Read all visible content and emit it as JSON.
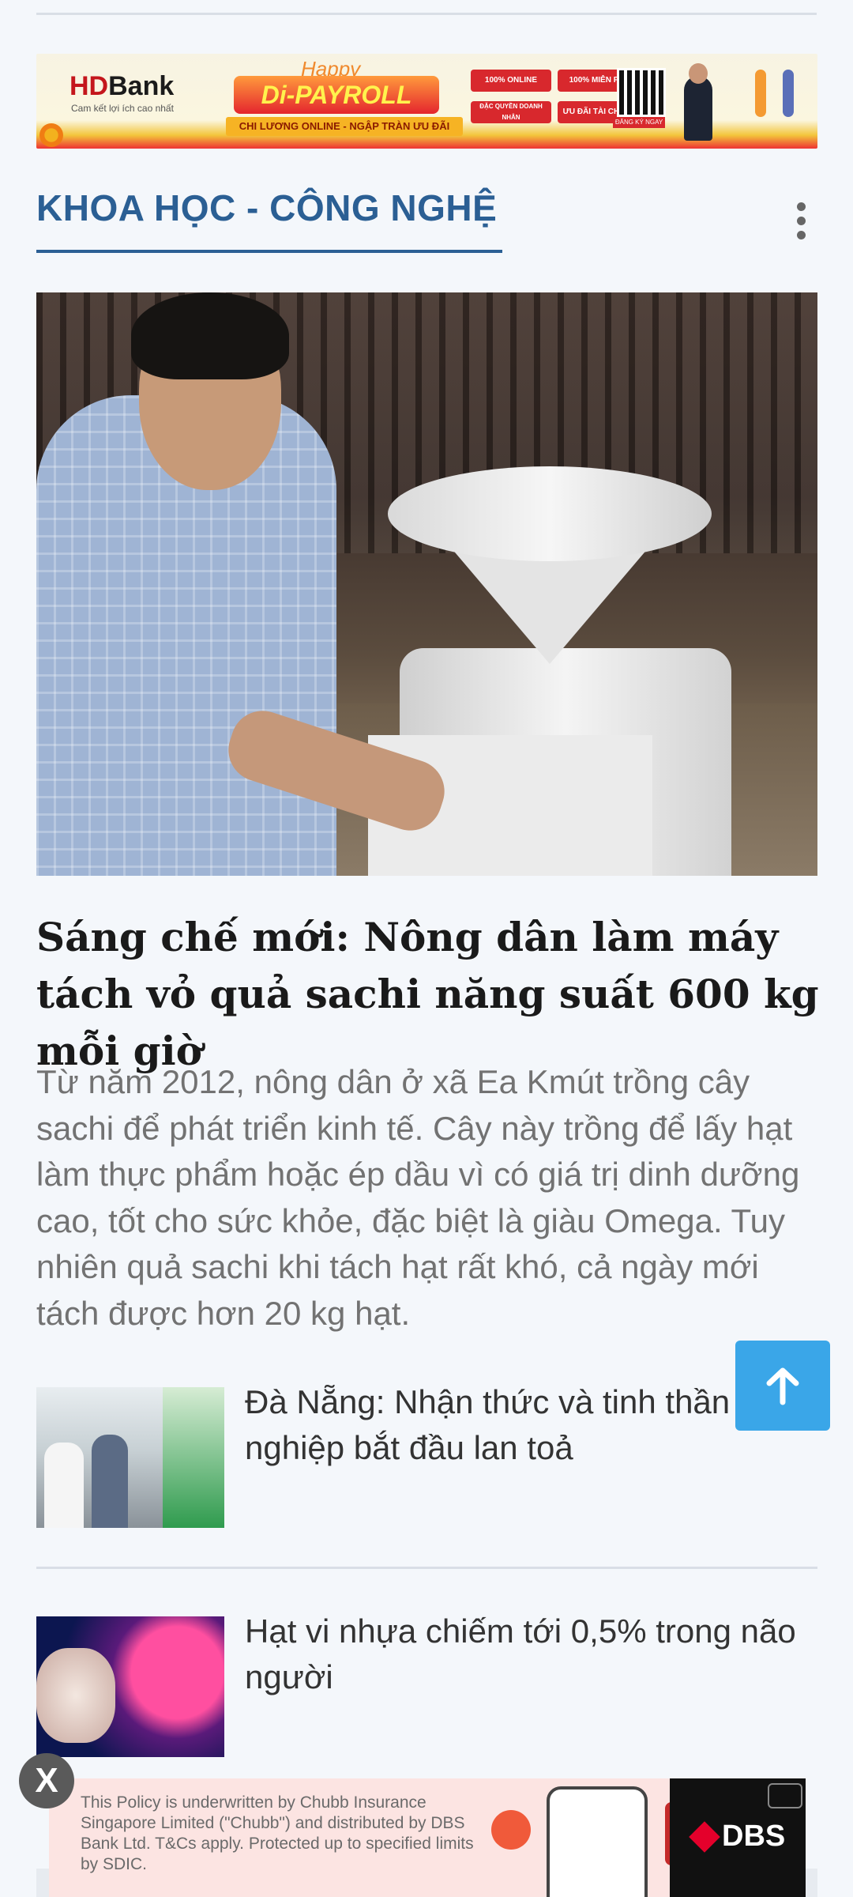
{
  "banner_top": {
    "brand": "HD",
    "brand_suffix": "Bank",
    "tagline": "Cam kết lợi ích cao nhất",
    "happy": "Happy",
    "payroll": "Di-PAYROLL",
    "sub": "CHI LƯƠNG ONLINE - NGẬP TRÀN ƯU ĐÃI",
    "pills": [
      "100% ONLINE",
      "100% MIỄN PHÍ",
      "ĐẶC QUYỀN DOANH NHÂN",
      "ƯU ĐÃI TÀI CHÍNH"
    ],
    "qr_label": "ĐĂNG KÝ NGAY"
  },
  "section": {
    "title": "KHOA HỌC - CÔNG NGHỆ"
  },
  "featured": {
    "headline": "Sáng chế mới: Nông dân làm máy tách vỏ quả sachi năng suất 600 kg mỗi giờ",
    "summary": "Từ năm 2012, nông dân ở xã Ea Kmút trồng cây sachi để phát triển kinh tế. Cây này trồng để lấy hạt làm thực phẩm hoặc ép dầu vì có giá trị dinh dưỡng cao, tốt cho sức khỏe, đặc biệt là giàu Omega. Tuy nhiên quả sachi khi tách hạt rất khó, cả ngày mới tách được hơn 20 kg hạt."
  },
  "related": [
    {
      "title": "Đà Nẵng: Nhận thức và tinh thần khởi nghiệp bắt đầu lan toả"
    },
    {
      "title": "Hạt vi nhựa chiếm tới 0,5% trong não người"
    }
  ],
  "ad_bottom": {
    "text": "This Policy is underwritten by Chubb Insurance Singapore Limited (\"Chubb\") and distributed by DBS Bank Ltd. T&Cs apply. Protected up to specified limits by SDIC.",
    "brand": "DBS",
    "close_label": "X"
  },
  "colors": {
    "accent": "#2b5f94",
    "to_top": "#3aa6e8",
    "summary_text": "#727272"
  },
  "icons": {
    "more": "more-vertical-icon",
    "to_top": "arrow-up-icon",
    "close": "close-icon"
  }
}
